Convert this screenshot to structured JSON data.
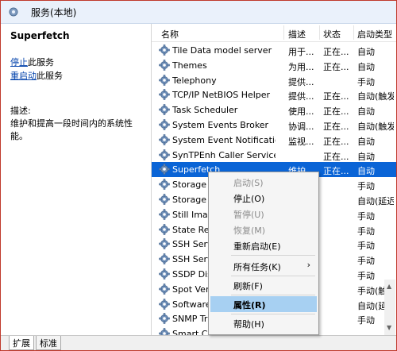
{
  "window": {
    "title": "服务(本地)"
  },
  "left": {
    "service_name": "Superfetch",
    "stop_link": "停止",
    "stop_suffix": "此服务",
    "restart_link": "重启动",
    "restart_suffix": "此服务",
    "desc_label": "描述:",
    "desc_text": "维护和提高一段时间内的系统性能。"
  },
  "columns": {
    "name": "名称",
    "desc": "描述",
    "status": "状态",
    "startup": "启动类型"
  },
  "rows": [
    {
      "name": "Tile Data model server",
      "desc": "用于...",
      "status": "正在...",
      "startup": "自动"
    },
    {
      "name": "Themes",
      "desc": "为用...",
      "status": "正在...",
      "startup": "自动"
    },
    {
      "name": "Telephony",
      "desc": "提供...",
      "status": "",
      "startup": "手动"
    },
    {
      "name": "TCP/IP NetBIOS Helper",
      "desc": "提供...",
      "status": "正在...",
      "startup": "自动(触发..."
    },
    {
      "name": "Task Scheduler",
      "desc": "使用...",
      "status": "正在...",
      "startup": "自动"
    },
    {
      "name": "System Events Broker",
      "desc": "协调...",
      "status": "正在...",
      "startup": "自动(触发..."
    },
    {
      "name": "System Event Notification...",
      "desc": "监视...",
      "status": "正在...",
      "startup": "自动"
    },
    {
      "name": "SynTPEnh Caller Service",
      "desc": "",
      "status": "正在...",
      "startup": "自动"
    },
    {
      "name": "Superfetch",
      "desc": "维护...",
      "status": "正在...",
      "startup": "自动"
    },
    {
      "name": "Storage T",
      "desc": "",
      "status": "",
      "startup": "手动"
    },
    {
      "name": "Storage S",
      "desc": "",
      "status": "",
      "startup": "自动(延迟..."
    },
    {
      "name": "Still Imag",
      "desc": "",
      "status": "",
      "startup": "手动"
    },
    {
      "name": "State Rep",
      "desc": "",
      "status": "",
      "startup": "手动"
    },
    {
      "name": "SSH Serv",
      "desc": "",
      "status": "",
      "startup": "手动"
    },
    {
      "name": "SSH Serv",
      "desc": "",
      "status": "",
      "startup": "手动"
    },
    {
      "name": "SSDP Dis",
      "desc": "",
      "status": "",
      "startup": "手动"
    },
    {
      "name": "Spot Ver",
      "desc": "",
      "status": "",
      "startup": "手动(触发..."
    },
    {
      "name": "Software",
      "desc": "",
      "status": "",
      "startup": "自动(延迟..."
    },
    {
      "name": "SNMP Tr",
      "desc": "",
      "status": "",
      "startup": "手动"
    },
    {
      "name": "Smart Ca",
      "desc": "",
      "status": "",
      "startup": ""
    }
  ],
  "context_menu": {
    "start": "启动(S)",
    "stop": "停止(O)",
    "pause": "暂停(U)",
    "resume": "恢复(M)",
    "restart": "重新启动(E)",
    "all_tasks": "所有任务(K)",
    "refresh": "刷新(F)",
    "properties": "属性(R)",
    "help": "帮助(H)"
  },
  "tabs": {
    "extended": "扩展",
    "standard": "标准"
  },
  "colors": {
    "selection": "#0a64d6",
    "menu_hover": "#a7d0f2",
    "link": "#0645ad"
  }
}
